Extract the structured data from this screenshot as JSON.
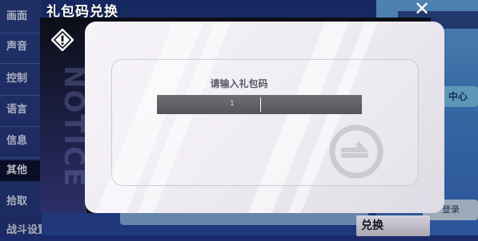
{
  "background_screen": {
    "side_menu_items": [
      "画面",
      "声音",
      "控制",
      "语言",
      "信息",
      "其他",
      "拾取",
      "战斗设置"
    ],
    "active_item_index": 5,
    "right_pill_label": "中心",
    "right_pill2_label": "登录"
  },
  "dialog": {
    "title": "礼包码兑换",
    "close_glyph": "✕",
    "notice_watermark": "NOTICE",
    "prompt": "请输入礼包码",
    "input_value": "",
    "input_mark": "1",
    "exchange_button_label": "兑换"
  },
  "colors": {
    "dialog_bg": "#f4f2f7",
    "input_bg": "#5f5e64",
    "menu_bg": "#2a3f84",
    "accent_blue": "#7ed0f2"
  },
  "icons": {
    "dialog_badge": "diamond-exclamation-icon",
    "close": "close-icon",
    "watermark": "arrow-circle-icon"
  }
}
